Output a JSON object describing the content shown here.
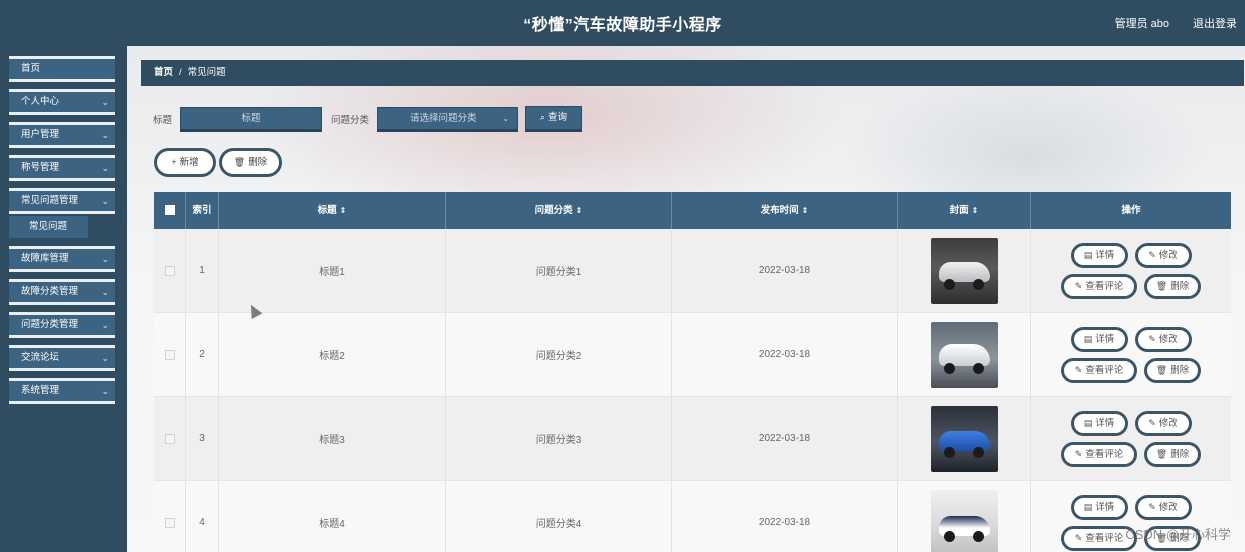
{
  "header": {
    "title": "“秒懂”汽车故障助手小程序",
    "user": "管理员 abo",
    "logout": "退出登录"
  },
  "sidebar": {
    "items": [
      {
        "label": "首页",
        "chevron": false
      },
      {
        "label": "个人中心",
        "chevron": true
      },
      {
        "label": "用户管理",
        "chevron": true
      },
      {
        "label": "称号管理",
        "chevron": true
      },
      {
        "label": "常见问题管理",
        "chevron": true
      },
      {
        "label": "故障库管理",
        "chevron": true
      },
      {
        "label": "故障分类管理",
        "chevron": true
      },
      {
        "label": "问题分类管理",
        "chevron": true
      },
      {
        "label": "交流论坛",
        "chevron": true
      },
      {
        "label": "系统管理",
        "chevron": true
      }
    ],
    "submenu": "常见问题"
  },
  "breadcrumb": {
    "home": "首页",
    "separator": "/",
    "current": "常见问题"
  },
  "search": {
    "title_label": "标题",
    "title_placeholder": "标题",
    "category_label": "问题分类",
    "category_placeholder": "请选择问题分类",
    "query_button": "查询"
  },
  "actions": {
    "add": "新增",
    "delete": "删除"
  },
  "table": {
    "columns": {
      "index": "索引",
      "title": "标题",
      "category": "问题分类",
      "date": "发布时间",
      "cover": "封面",
      "ops": "操作"
    },
    "ops": {
      "detail": "详情",
      "edit": "修改",
      "comment": "查看评论",
      "delete": "删除"
    },
    "rows": [
      {
        "index": "1",
        "title": "标题1",
        "category": "问题分类1",
        "date": "2022-03-18",
        "cover": "white-sports-car"
      },
      {
        "index": "2",
        "title": "标题2",
        "category": "问题分类2",
        "date": "2022-03-18",
        "cover": "white-sedan"
      },
      {
        "index": "3",
        "title": "标题3",
        "category": "问题分类3",
        "date": "2022-03-18",
        "cover": "blue-coupe"
      },
      {
        "index": "4",
        "title": "标题4",
        "category": "问题分类4",
        "date": "2022-03-18",
        "cover": "white-concept-car"
      }
    ]
  },
  "watermark": "CSDN @开心科学"
}
